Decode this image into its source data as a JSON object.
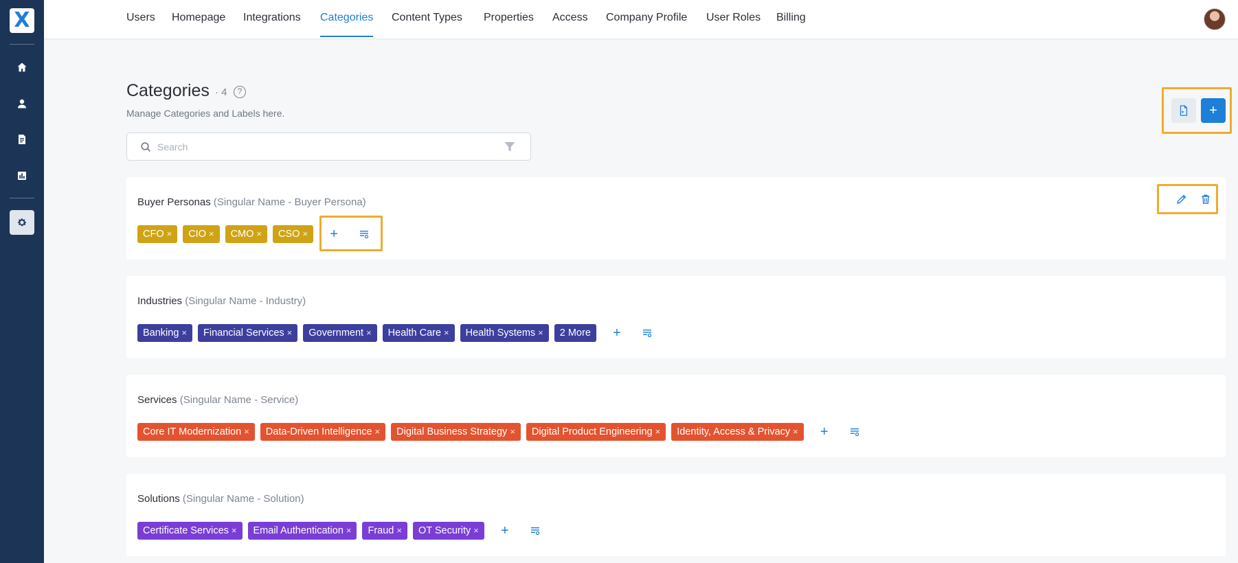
{
  "brand": {
    "logo_letter": "X"
  },
  "colors": {
    "sidebar": "#1c3557",
    "accent": "#1e7fd8",
    "highlight": "#f0ab2e",
    "buyer_personas": "#cfa315",
    "industries": "#3c3f9e",
    "services": "#e4532f",
    "solutions": "#7a3ed6"
  },
  "sidebar": {
    "items": [
      {
        "icon": "home-icon"
      },
      {
        "icon": "user-icon"
      },
      {
        "icon": "document-icon"
      },
      {
        "icon": "chart-icon"
      },
      {
        "icon": "settings-icon",
        "active": true
      }
    ]
  },
  "nav": {
    "tabs": [
      {
        "label": "Users"
      },
      {
        "label": "Homepage"
      },
      {
        "label": "Integrations"
      },
      {
        "label": "Categories",
        "active": true
      },
      {
        "label": "Content Types"
      },
      {
        "label": "Properties"
      },
      {
        "label": "Access"
      },
      {
        "label": "Company Profile"
      },
      {
        "label": "User Roles"
      },
      {
        "label": "Billing"
      }
    ]
  },
  "header": {
    "title": "Categories",
    "count": "· 4",
    "help": "?",
    "subtitle": "Manage Categories and Labels here."
  },
  "search": {
    "placeholder": "Search",
    "value": ""
  },
  "remove_glyph": "×",
  "add_glyph": "+",
  "categories": [
    {
      "name": "Buyer Personas",
      "singular": "(Singular Name - Buyer Persona)",
      "labels": [
        "CFO",
        "CIO",
        "CMO",
        "CSO"
      ]
    },
    {
      "name": "Industries",
      "singular": "(Singular Name - Industry)",
      "labels": [
        "Banking",
        "Financial Services",
        "Government",
        "Health Care",
        "Health Systems"
      ],
      "more": "2 More"
    },
    {
      "name": "Services",
      "singular": "(Singular Name - Service)",
      "labels": [
        "Core IT Modernization",
        "Data-Driven Intelligence",
        "Digital Business Strategy",
        "Digital Product Engineering",
        "Identity, Access & Privacy"
      ]
    },
    {
      "name": "Solutions",
      "singular": "(Singular Name - Solution)",
      "labels": [
        "Certificate Services",
        "Email Authentication",
        "Fraud",
        "OT Security"
      ]
    }
  ]
}
